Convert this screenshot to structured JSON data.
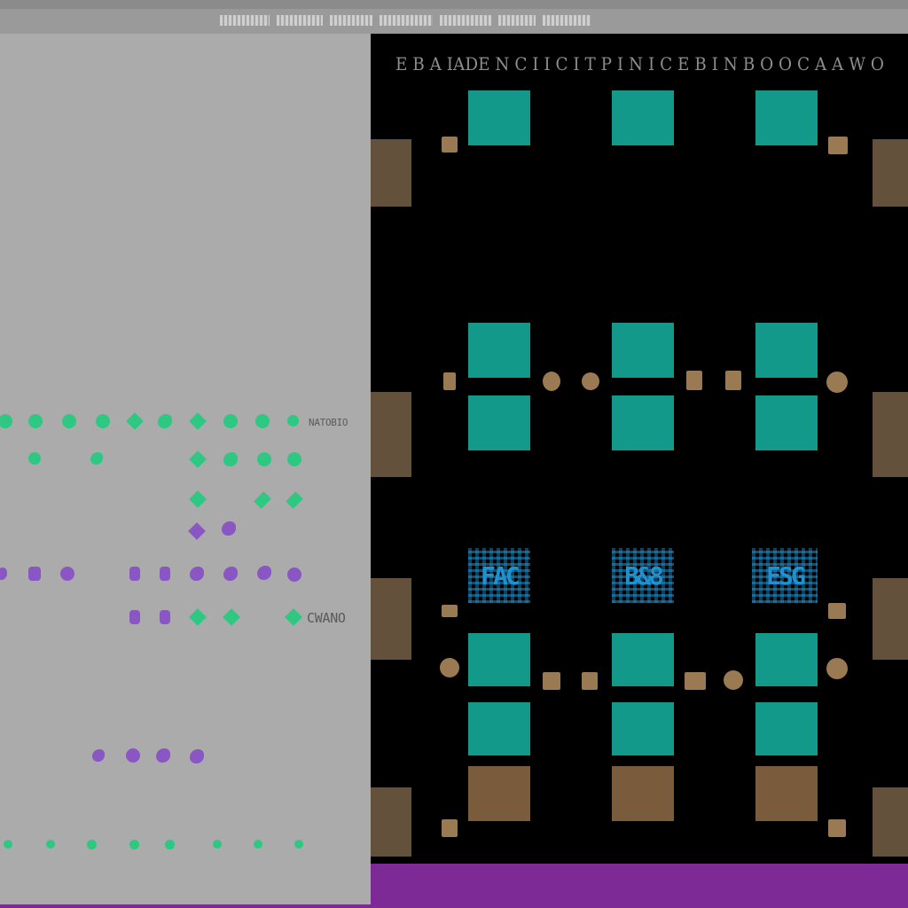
{
  "window": {
    "menu_labels": [
      "File",
      "Edit",
      "View",
      "Place",
      "Route",
      "Tools",
      "Help"
    ]
  },
  "board": {
    "caption": "E B  A IADE N C I I C I T P I N I C E   B  I  N  B O O C  A  A  W O"
  },
  "side_panel": {
    "row_tag_1": "NATOBIO",
    "row_tag_2": "CWANO"
  },
  "colors": {
    "green": "#2ec882",
    "purple": "#8a56c4",
    "pad": "#12998a",
    "component": "#6e5538",
    "status_bar": "#7d2a96"
  },
  "icons": {
    "dot": "circle-marker",
    "diamond": "diamond-marker"
  }
}
